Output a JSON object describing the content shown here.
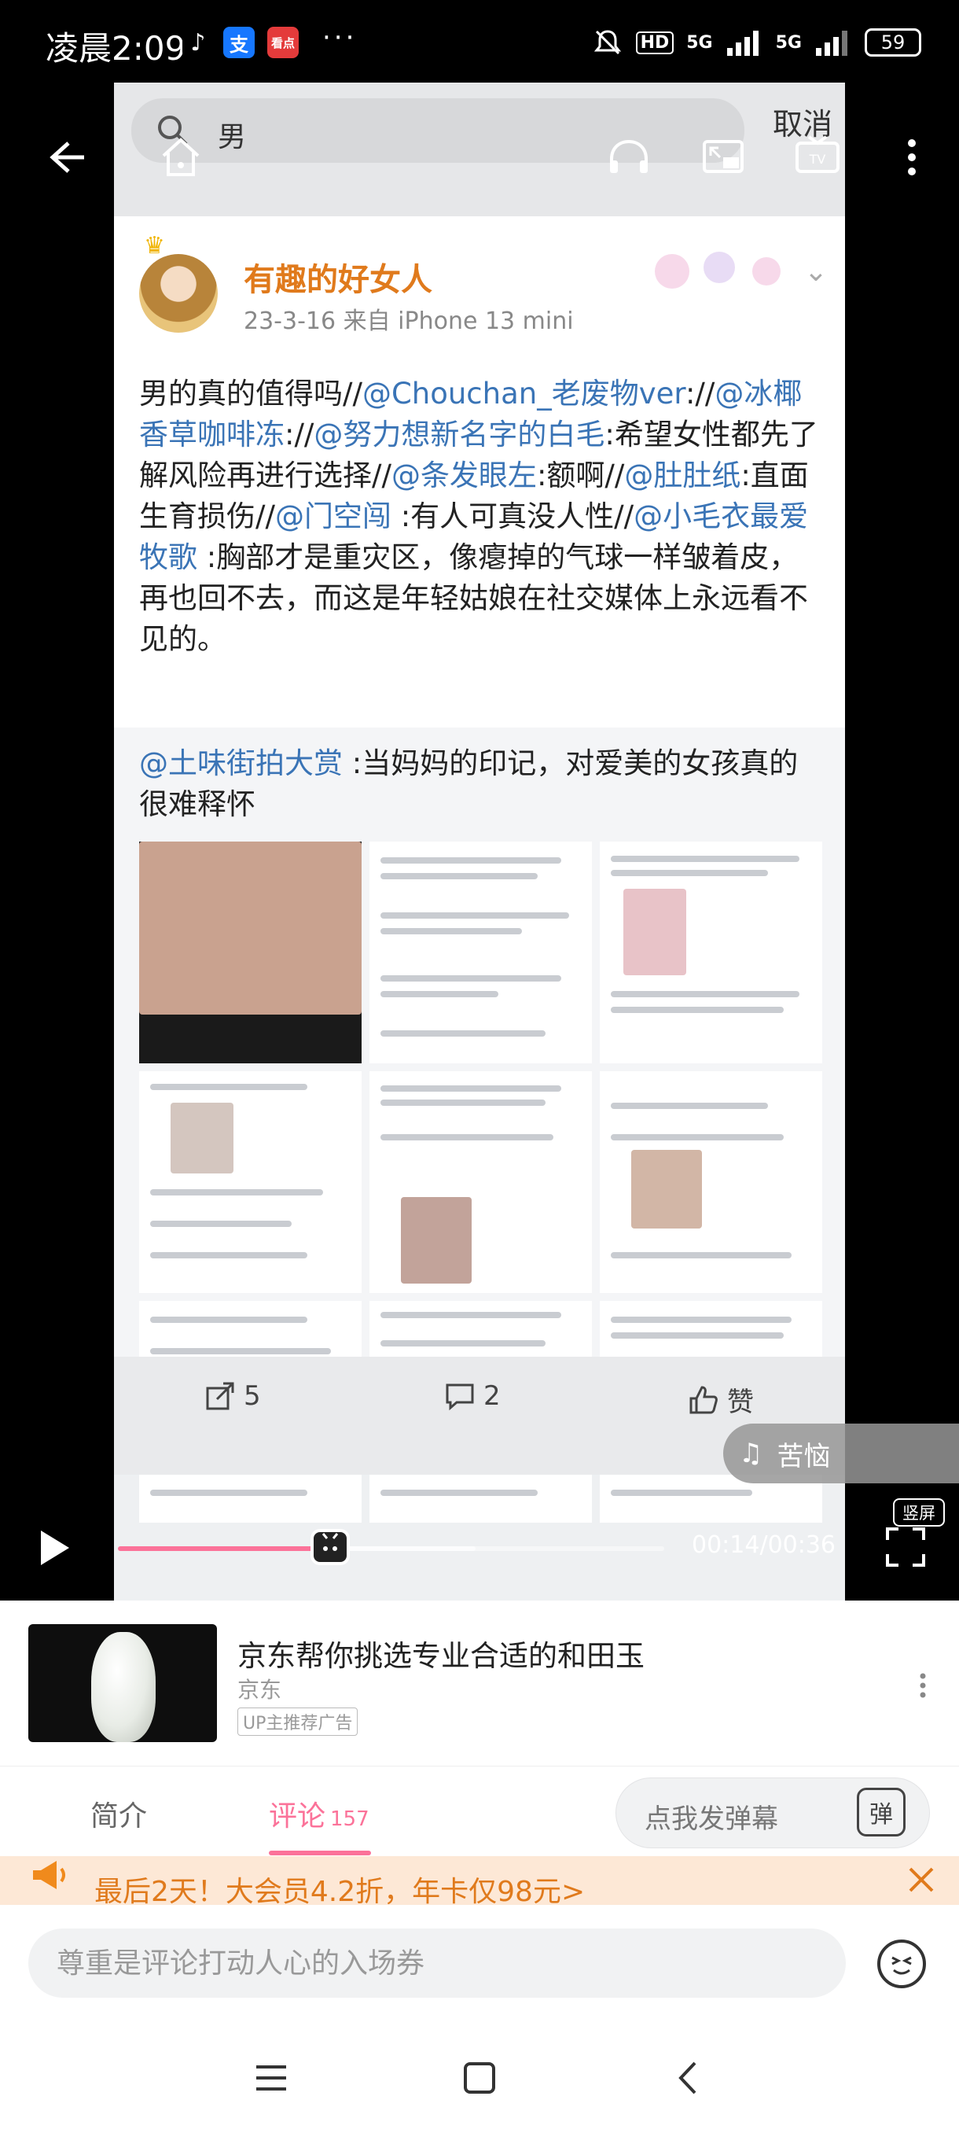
{
  "status_bar": {
    "time": "凌晨2:09",
    "app_icons": [
      "tiktok-icon",
      "alipay-icon",
      "news-icon"
    ],
    "alipay_label": "支",
    "news_label": "看点",
    "more": "···",
    "hd_label": "HD",
    "network_1": "5G",
    "network_2": "5G",
    "battery": "59"
  },
  "video": {
    "frame": {
      "search_query": "男",
      "cancel_label": "取消",
      "poster_name": "有趣的好女人",
      "poster_meta": "23-3-16  来自 iPhone 13 mini",
      "post_segments": [
        {
          "text": "男的真的值得吗//",
          "mention": false
        },
        {
          "text": "@Chouchan_老废物ver",
          "mention": true
        },
        {
          "text": "://",
          "mention": false
        },
        {
          "text": "@冰椰香草咖啡冻",
          "mention": true
        },
        {
          "text": "://",
          "mention": false
        },
        {
          "text": "@努力想新名字的白毛",
          "mention": true
        },
        {
          "text": ":希望女性都先了解风险再进行选择//",
          "mention": false
        },
        {
          "text": "@条发眼左",
          "mention": true
        },
        {
          "text": ":额啊//",
          "mention": false
        },
        {
          "text": "@肚肚纸",
          "mention": true
        },
        {
          "text": ":直面生育损伤//",
          "mention": false
        },
        {
          "text": "@门空闯",
          "mention": true
        },
        {
          "text": " :有人可真没人性//",
          "mention": false
        },
        {
          "text": "@小毛衣最爱牧歌",
          "mention": true
        },
        {
          "text": " :胸部才是重灾区，像瘪掉的气球一样皱着皮，再也回不去，而这是年轻姑娘在社交媒体上永远看不见的。",
          "mention": false
        }
      ],
      "repost_mention": "@土味街拍大赏",
      "repost_text": " :当妈妈的印记，对爱美的女孩真的很难释怀",
      "share_count": "5",
      "comment_count": "2",
      "like_label": "赞"
    },
    "music_chip": "苦恼",
    "portrait_label": "竖屏",
    "time_readout": "00:14/00:36",
    "progress_fraction": 0.3889
  },
  "ad": {
    "title": "京东帮你挑选专业合适的和田玉",
    "brand": "京东",
    "tag": "UP主推荐广告"
  },
  "tabs": {
    "intro": "简介",
    "comments": "评论",
    "comments_count": "157",
    "danmaku_placeholder": "点我发弹幕",
    "danmaku_icon_label": "弹"
  },
  "promo": {
    "text": "最后2天！大会员4.2折，年卡仅98元>"
  },
  "comment_input": {
    "placeholder": "尊重是评论打动人心的入场券"
  },
  "colors": {
    "accent": "#fb7299",
    "mention": "#3a74b6",
    "promo": "#e07a1c"
  }
}
